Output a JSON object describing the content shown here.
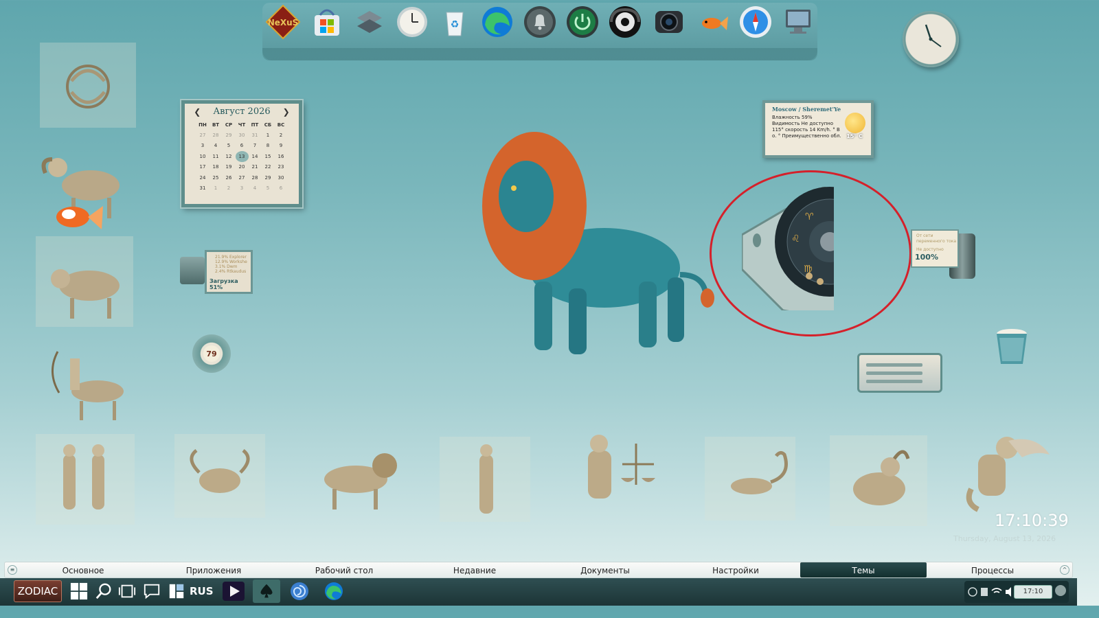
{
  "dock": {
    "items": [
      {
        "name": "nexus-logo",
        "label": "NeXuS"
      },
      {
        "name": "windows-store",
        "label": "Store"
      },
      {
        "name": "widgets",
        "label": "Widgets"
      },
      {
        "name": "clock-app",
        "label": "Clock"
      },
      {
        "name": "recycle-bin",
        "label": "Recycle Bin"
      },
      {
        "name": "edge-browser",
        "label": "Edge"
      },
      {
        "name": "notifications",
        "label": "Bell"
      },
      {
        "name": "power",
        "label": "Power"
      },
      {
        "name": "music",
        "label": "Music"
      },
      {
        "name": "camera",
        "label": "Camera"
      },
      {
        "name": "goldfish",
        "label": "Fish"
      },
      {
        "name": "safari",
        "label": "Browser"
      },
      {
        "name": "computer",
        "label": "Computer"
      }
    ]
  },
  "calendar": {
    "title": "Август 2026",
    "weekdays": [
      "ПН",
      "ВТ",
      "СР",
      "ЧТ",
      "ПТ",
      "СБ",
      "ВС"
    ],
    "weeks": [
      [
        "27",
        "28",
        "29",
        "30",
        "31",
        "1",
        "2"
      ],
      [
        "3",
        "4",
        "5",
        "6",
        "7",
        "8",
        "9"
      ],
      [
        "10",
        "11",
        "12",
        "13",
        "14",
        "15",
        "16"
      ],
      [
        "17",
        "18",
        "19",
        "20",
        "21",
        "22",
        "23"
      ],
      [
        "24",
        "25",
        "26",
        "27",
        "28",
        "29",
        "30"
      ],
      [
        "31",
        "1",
        "2",
        "3",
        "4",
        "5",
        "6"
      ]
    ],
    "today": "13"
  },
  "weather": {
    "city": "Moscow / Sheremet'Ye",
    "lines": [
      "Влажность 59%",
      "Видимость Не доступно",
      "115° скорость 14 Km/h. ° В",
      "о. ° Преимущественно обл."
    ],
    "temp": "15° C"
  },
  "cpu": {
    "lines": [
      "21.9% Explorer",
      "12.9% Workshe",
      "3.1% Dwm",
      "2.4% Rtkaudus"
    ],
    "load": "Загрузка 51%"
  },
  "dial": {
    "value": "79"
  },
  "battery": {
    "lines": [
      "От сети переменного тока",
      "Не доступно"
    ],
    "percent": "100%"
  },
  "time": {
    "clock": "17:10:39",
    "date": "Thursday, August 13, 2026"
  },
  "categories": [
    {
      "label": "Основное",
      "active": false
    },
    {
      "label": "Приложения",
      "active": false
    },
    {
      "label": "Рабочий стол",
      "active": false
    },
    {
      "label": "Недавние",
      "active": false
    },
    {
      "label": "Документы",
      "active": false
    },
    {
      "label": "Настройки",
      "active": false
    },
    {
      "label": "Темы",
      "active": true
    },
    {
      "label": "Процессы",
      "active": false
    }
  ],
  "taskbar": {
    "start_label": "ZODIAC",
    "lang": "RUS",
    "tray_time": "17:10"
  },
  "colors": {
    "accent": "#2a4b4e",
    "highlight": "#d5202a",
    "background": "#79b6bb"
  }
}
